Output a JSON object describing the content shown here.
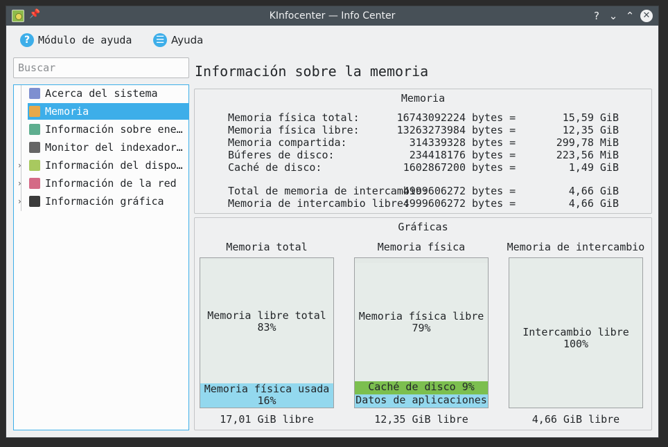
{
  "window": {
    "title": "KInfocenter — Info Center"
  },
  "titlebar": {
    "help_glyph": "?",
    "min_glyph": "⌄",
    "max_glyph": "⌃",
    "close_glyph": "✕"
  },
  "toolbar": {
    "module_help_label": "Módulo de ayuda",
    "help_label": "Ayuda"
  },
  "search": {
    "placeholder": "Buscar"
  },
  "sidebar": {
    "items": [
      {
        "label": "Acerca del sistema",
        "icon": "info-icon",
        "color": "#7e8fd0"
      },
      {
        "label": "Memoria",
        "icon": "memory-icon",
        "color": "#e8a84a",
        "selected": true
      },
      {
        "label": "Información sobre energía",
        "icon": "battery-icon",
        "color": "#5eae8f"
      },
      {
        "label": "Monitor del indexador de archivos",
        "icon": "search-icon",
        "color": "#666666"
      },
      {
        "label": "Información del dispositivo",
        "icon": "device-icon",
        "color": "#a8c95f"
      },
      {
        "label": "Información de la red",
        "icon": "network-icon",
        "color": "#d46a86"
      },
      {
        "label": "Información gráfica",
        "icon": "graphics-icon",
        "color": "#3b3b3b"
      }
    ]
  },
  "main": {
    "title": "Información sobre la memoria",
    "memory": {
      "group_title": "Memoria",
      "rows": [
        {
          "label": "Memoria física total:",
          "bytes": "16743092224",
          "unit": "bytes =",
          "human": "15,59 GiB"
        },
        {
          "label": "Memoria física libre:",
          "bytes": "13263273984",
          "unit": "bytes =",
          "human": "12,35 GiB"
        },
        {
          "label": "Memoria compartida:",
          "bytes": "314339328",
          "unit": "bytes =",
          "human": "299,78 MiB"
        },
        {
          "label": "Búferes de disco:",
          "bytes": "234418176",
          "unit": "bytes =",
          "human": "223,56 MiB"
        },
        {
          "label": "Caché de disco:",
          "bytes": "1602867200",
          "unit": "bytes =",
          "human": "1,49 GiB"
        },
        {
          "label": "Total de memoria de intercambio:",
          "bytes": "4999606272",
          "unit": "bytes =",
          "human": "4,66 GiB"
        },
        {
          "label": "Memoria de intercambio libre:",
          "bytes": "4999606272",
          "unit": "bytes =",
          "human": "4,66 GiB"
        }
      ]
    },
    "graphs": {
      "group_title": "Gráficas",
      "charts": [
        {
          "title": "Memoria total",
          "footer": "17,01 GiB libre",
          "segments": [
            {
              "label": "Memoria libre total",
              "percent_text": "83%",
              "fraction": 0.83,
              "color": "#e6ece9"
            },
            {
              "label": "Memoria física usada",
              "percent_text": "16%",
              "fraction": 0.16,
              "color": "#93d8ee"
            }
          ]
        },
        {
          "title": "Memoria física",
          "footer": "12,35 GiB libre",
          "segments": [
            {
              "label": "Memoria física libre",
              "percent_text": "79%",
              "fraction": 0.79,
              "color": "#e6ece9"
            },
            {
              "label": "Caché de disco 9%",
              "percent_text": "",
              "fraction": 0.09,
              "color": "#7cbf4f"
            },
            {
              "label": "Datos de aplicaciones",
              "percent_text": "9%",
              "fraction": 0.09,
              "color": "#93d8ee"
            }
          ]
        },
        {
          "title": "Memoria de intercambio",
          "footer": "4,66 GiB libre",
          "segments": [
            {
              "label": "Intercambio libre 100%",
              "percent_text": "",
              "fraction": 1.0,
              "color": "#e6ece9"
            }
          ]
        }
      ]
    }
  }
}
